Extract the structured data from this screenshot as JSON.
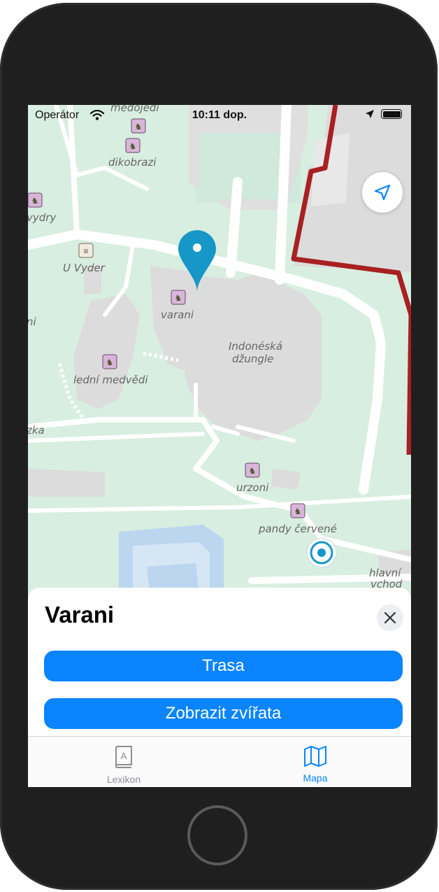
{
  "status_bar": {
    "carrier": "Operátor",
    "time": "10:11 dop."
  },
  "map": {
    "labels": {
      "medojedi": "medojedi",
      "dikobrazi": "dikobrazi",
      "vydry": "vydry",
      "u_vyder": "U Vyder",
      "varani": "varani",
      "indonesian": "Indonéská\ndžungle",
      "lednimedvedi": "lední medvědi",
      "zka": "zka",
      "urzoni": "urzoni",
      "pandy": "pandy červené",
      "hlavni": "hlavní",
      "vchod": "vchod",
      "ni": "ni"
    }
  },
  "sheet": {
    "title": "Varani",
    "route_button": "Trasa",
    "animals_button": "Zobrazit zvířata"
  },
  "tabbar": {
    "tabs": [
      {
        "label": "Lexikon",
        "active": false,
        "color": "#8e8e93"
      },
      {
        "label": "Mapa",
        "active": true,
        "color": "#0a84ff"
      }
    ]
  },
  "colors": {
    "accent": "#0a84ff",
    "map_green": "#cfe9d9",
    "building": "#dcdcdc",
    "boundary": "#a82022"
  }
}
